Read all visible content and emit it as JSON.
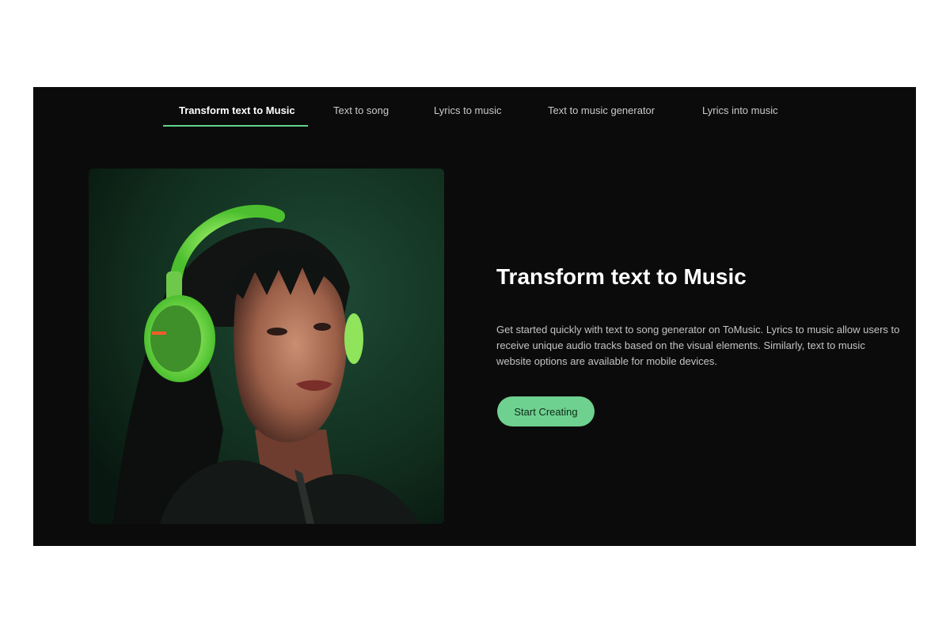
{
  "tabs": [
    {
      "label": "Transform text to Music",
      "active": true
    },
    {
      "label": "Text to song",
      "active": false
    },
    {
      "label": "Lyrics to music",
      "active": false
    },
    {
      "label": "Text to music generator",
      "active": false
    },
    {
      "label": "Lyrics into music",
      "active": false
    }
  ],
  "hero": {
    "image": "woman-with-green-headphones-photo",
    "title": "Transform text to Music",
    "description": "Get started quickly with text to song generator on ToMusic. Lyrics to music allow users to receive unique audio tracks based on the visual elements. Similarly, text to music website options are available for mobile devices.",
    "cta_label": "Start Creating"
  },
  "colors": {
    "background": "#0b0b0b",
    "accent": "#6fd18f",
    "underline": "#5fd48a",
    "headphones": "#7ee05a"
  }
}
